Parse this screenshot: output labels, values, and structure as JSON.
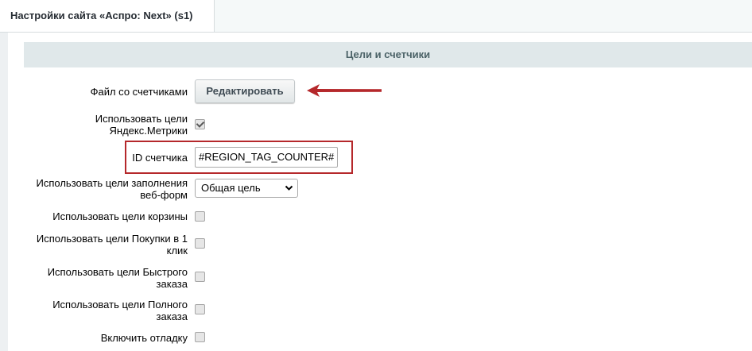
{
  "tab": {
    "title": "Настройки сайта «Аспро: Next» (s1)"
  },
  "section": {
    "title": "Цели и счетчики"
  },
  "fields": {
    "counters_file": {
      "label": "Файл со счетчиками",
      "button_label": "Редактировать"
    },
    "use_yandex_metrika": {
      "label_line1": "Использовать цели",
      "label_line2": "Яндекс.Метрики",
      "checked": true
    },
    "counter_id": {
      "label": "ID счетчика",
      "value": "#REGION_TAG_COUNTER#"
    },
    "webform_goals": {
      "label_line1": "Использовать цели заполнения",
      "label_line2": "веб-форм",
      "selected": "Общая цель"
    },
    "basket_goals": {
      "label": "Использовать цели корзины",
      "checked": false
    },
    "one_click_goals": {
      "label_line1": "Использовать цели Покупки в 1",
      "label_line2": "клик",
      "checked": false
    },
    "quick_order_goals": {
      "label_line1": "Использовать цели Быстрого",
      "label_line2": "заказа",
      "checked": false
    },
    "full_order_goals": {
      "label_line1": "Использовать цели Полного",
      "label_line2": "заказа",
      "checked": false
    },
    "debug": {
      "label": "Включить отладку",
      "checked": false
    }
  },
  "colors": {
    "accent_red": "#b5282b",
    "section_header_bg": "#e0e8ea"
  },
  "icons": {
    "arrow": "arrow-left-icon",
    "select": "chevron-down-icon",
    "check": "checkmark-icon"
  }
}
